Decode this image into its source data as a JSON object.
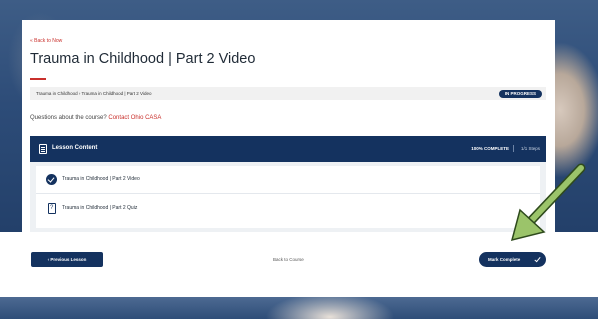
{
  "page": {
    "back_link": "« Back to Now",
    "title": "Trauma in Childhood | Part 2 Video",
    "breadcrumb": "Trauma in Childhood › Trauma in Childhood | Part 2 Video",
    "status_badge": "IN PROGRESS",
    "questions_text": "Questions about the course? ",
    "questions_link": "Contact Ohio CASA"
  },
  "lesson": {
    "header_title": "Lesson Content",
    "complete_text": "100% COMPLETE",
    "steps_text": "1/1 Steps",
    "items": [
      {
        "label": "Trauma in Childhood | Part 2 Video",
        "icon": "check-circle-icon",
        "completed": true
      },
      {
        "label": "Trauma in Childhood | Part 2 Quiz",
        "icon": "quiz-icon",
        "completed": false
      }
    ]
  },
  "nav": {
    "previous_label": "‹  Previous Lesson",
    "back_to_course": "Back to Course",
    "mark_complete": "Mark Complete"
  },
  "colors": {
    "primary_navy": "#14325f",
    "accent_red": "#c9302c",
    "annotation_arrow": "#9bc46a"
  }
}
